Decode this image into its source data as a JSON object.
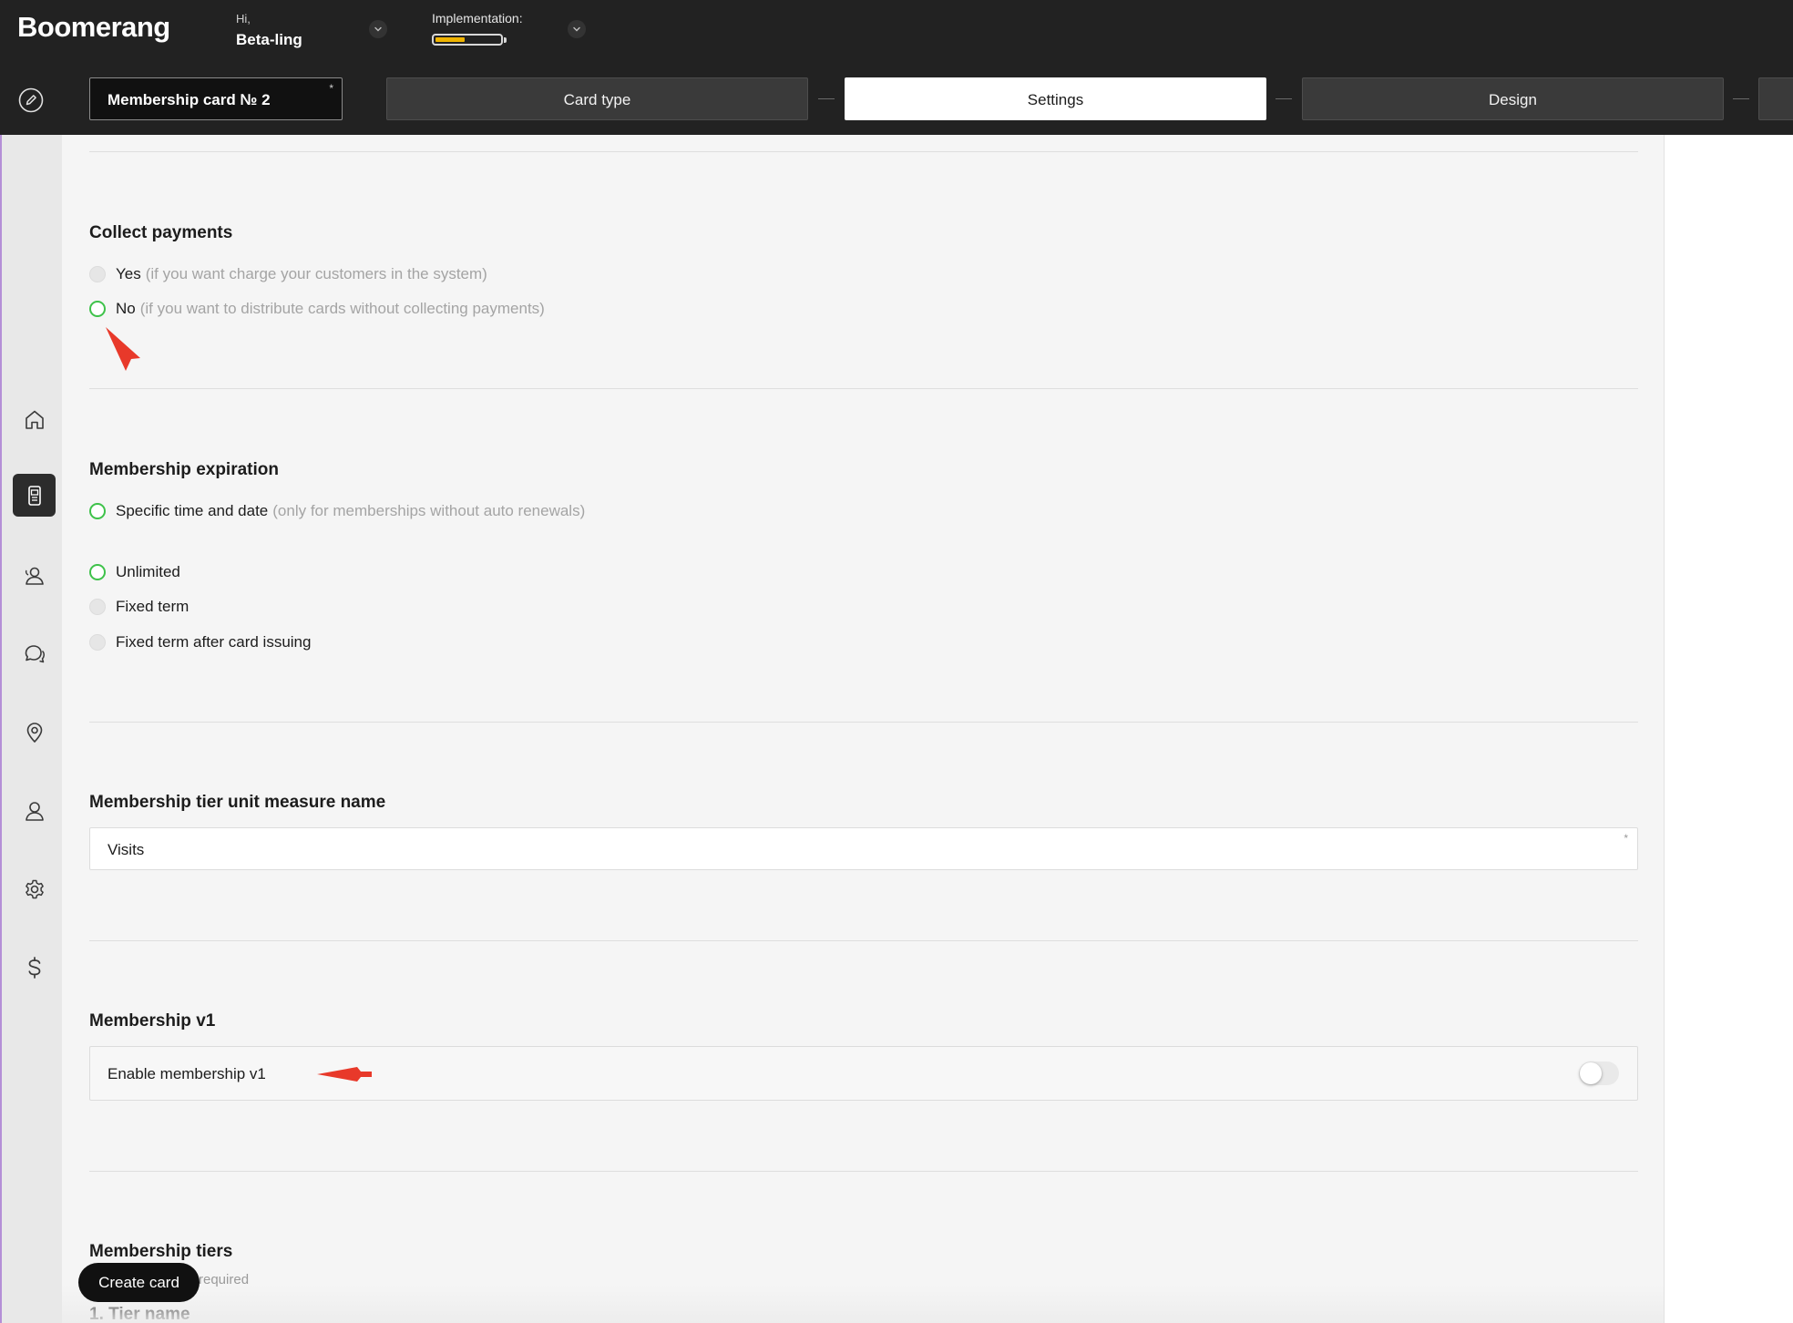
{
  "header": {
    "logo": "Boomerang",
    "greeting": "Hi,",
    "user_name": "Beta-ling",
    "implementation_label": "Implementation:",
    "implementation_progress": 0.45
  },
  "steps": {
    "card_name": "Membership card № 2",
    "card_name_required": "*",
    "items": [
      {
        "label": "Card type",
        "active": false
      },
      {
        "label": "Settings",
        "active": true
      },
      {
        "label": "Design",
        "active": false
      }
    ]
  },
  "sidebar": {
    "items": [
      {
        "icon": "home-icon"
      },
      {
        "icon": "card-device-icon",
        "active": true
      },
      {
        "icon": "customers-icon"
      },
      {
        "icon": "chat-icon"
      },
      {
        "icon": "location-pin-icon"
      },
      {
        "icon": "user-icon"
      },
      {
        "icon": "gear-icon"
      },
      {
        "icon": "dollar-icon"
      }
    ]
  },
  "collect_payments": {
    "title": "Collect payments",
    "options": [
      {
        "label": "Yes",
        "hint": "(if you want charge your customers in the system)",
        "selected": false
      },
      {
        "label": "No",
        "hint": "(if you want to distribute cards without collecting payments)",
        "selected": true
      }
    ]
  },
  "membership_expiration": {
    "title": "Membership expiration",
    "options": [
      {
        "label": "Specific time and date",
        "hint": "(only for memberships without auto renewals)",
        "selected": true
      },
      {
        "label": "Unlimited",
        "selected": true
      },
      {
        "label": "Fixed term",
        "selected": false
      },
      {
        "label": "Fixed term after card issuing",
        "selected": false
      }
    ]
  },
  "tier_unit": {
    "title": "Membership tier unit measure name",
    "value": "Visits",
    "required": "*"
  },
  "membership_v1": {
    "title": "Membership v1",
    "toggle_label": "Enable membership v1",
    "enabled": false
  },
  "membership_tiers": {
    "title": "Membership tiers",
    "required_note": "required",
    "tier_label": "1. Tier name"
  },
  "footer": {
    "create_button": "Create card"
  },
  "colors": {
    "topbar": "#222222",
    "radio_selected": "#3ec24a",
    "annotation_arrow": "#e8392a",
    "progress_fill": "#f0b400"
  }
}
